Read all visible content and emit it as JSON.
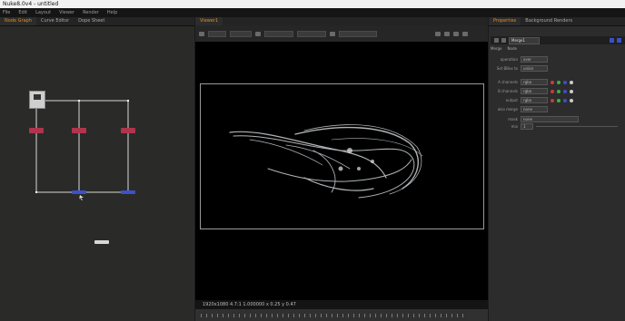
{
  "window": {
    "title": "Nuke8.0v4 - untitled"
  },
  "menu": [
    "File",
    "Edit",
    "Layout",
    "Viewer",
    "Render",
    "Help"
  ],
  "nodegraph_tabs": [
    "Node Graph",
    "Curve Editor",
    "Dope Sheet"
  ],
  "viewer_tabs": [
    "Viewer1"
  ],
  "props_tabs": [
    "Properties",
    "Background Renders"
  ],
  "props": {
    "node_name": "Merge1",
    "inner_tabs": [
      "Merge",
      "Node"
    ],
    "rows": [
      {
        "label": "operation",
        "value": "over"
      },
      {
        "label": "Set BBox to",
        "value": "union"
      },
      {
        "label": "A channels",
        "value": "rgba"
      },
      {
        "label": "B channels",
        "value": "rgba"
      },
      {
        "label": "output",
        "value": "rgba"
      },
      {
        "label": "also merge",
        "value": "none"
      },
      {
        "label": "mask",
        "value": "none"
      },
      {
        "label": "mix",
        "value": "1"
      }
    ]
  },
  "viewer": {
    "status": "1920x1080 4.7:1 1.000000 x 0.25 y 0.47"
  }
}
